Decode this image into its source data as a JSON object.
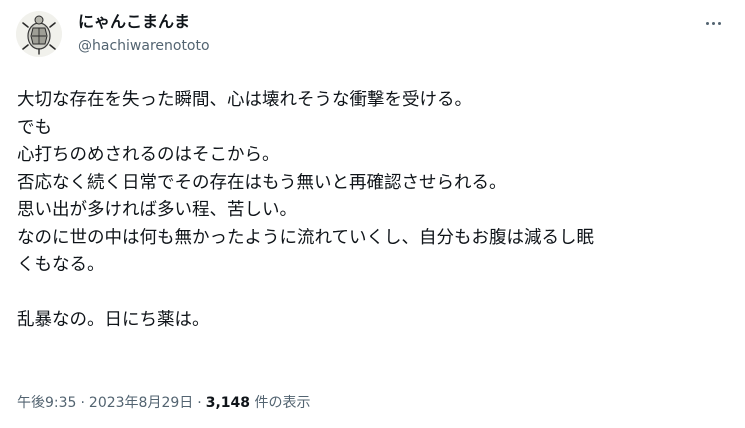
{
  "user": {
    "display_name": "にゃんこまんま",
    "handle": "@hachiwarenototo",
    "avatar_icon": "turtle-illustration-avatar"
  },
  "tweet": {
    "lines": [
      "大切な存在を失った瞬間、心は壊れそうな衝撃を受ける。",
      "でも",
      "心打ちのめされるのはそこから。",
      "否応なく続く日常でその存在はもう無いと再確認させられる。",
      "思い出が多ければ多い程、苦しい。",
      "なのに世の中は何も無かったように流れていくし、自分もお腹は減るし眠",
      "くもなる。",
      "",
      "乱暴なの。日にち薬は。"
    ]
  },
  "meta": {
    "time": "午後9:35",
    "separator": "·",
    "date": "2023年8月29日",
    "views_count": "3,148",
    "views_label": " 件の表示"
  },
  "icons": {
    "more": "more-horizontal-icon"
  },
  "colors": {
    "text": "#0f1419",
    "secondary": "#536471",
    "background": "#ffffff"
  }
}
